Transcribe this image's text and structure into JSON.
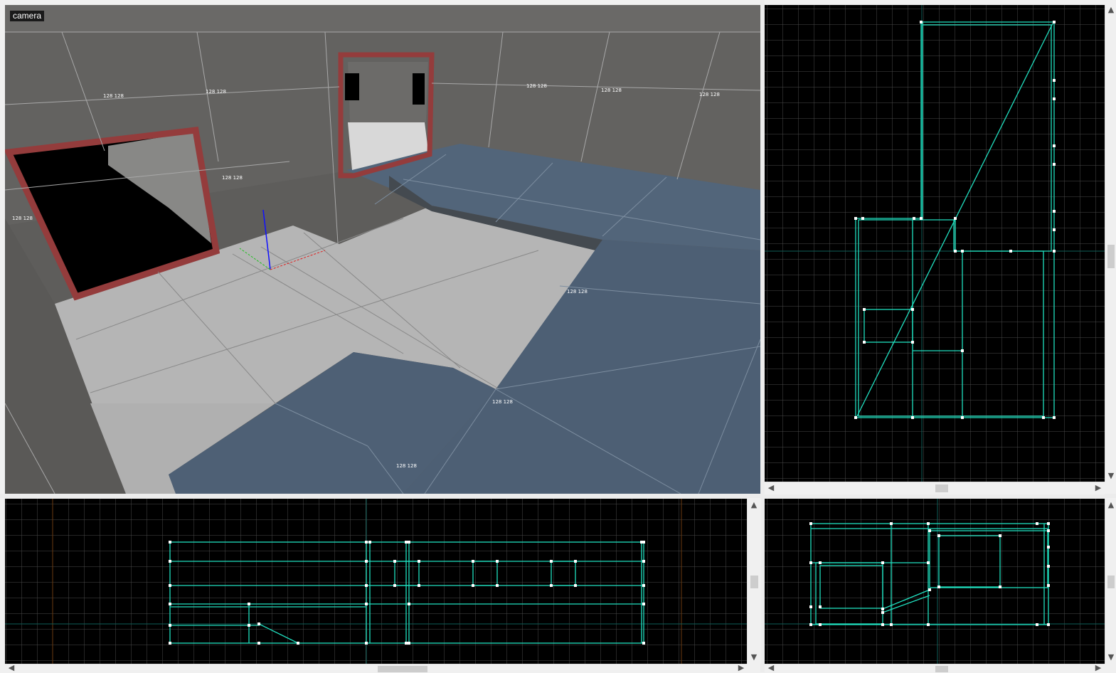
{
  "camera_view": {
    "label": "camera"
  },
  "texture_labels": [
    {
      "text": "128 128"
    },
    {
      "text": "128 128"
    },
    {
      "text": "128 128"
    },
    {
      "text": "128 128"
    },
    {
      "text": "128 128"
    },
    {
      "text": "128 128"
    },
    {
      "text": "128 128"
    },
    {
      "text": "128 128"
    },
    {
      "text": "128 128"
    },
    {
      "text": "128 128"
    }
  ],
  "colors": {
    "grid_background": "#000000",
    "grid_line": "#4a4a4a",
    "grid_axis": "#0e5e57",
    "brush_outline": "#20e0c0",
    "wall_gray": "#636260",
    "floor_light": "#b6b6b6",
    "floor_blue": "#4e6075",
    "door_frame": "#943c3c"
  },
  "scrollbars": {
    "up_arrow": "▲",
    "down_arrow": "▼",
    "left_arrow": "◀",
    "right_arrow": "▶"
  }
}
